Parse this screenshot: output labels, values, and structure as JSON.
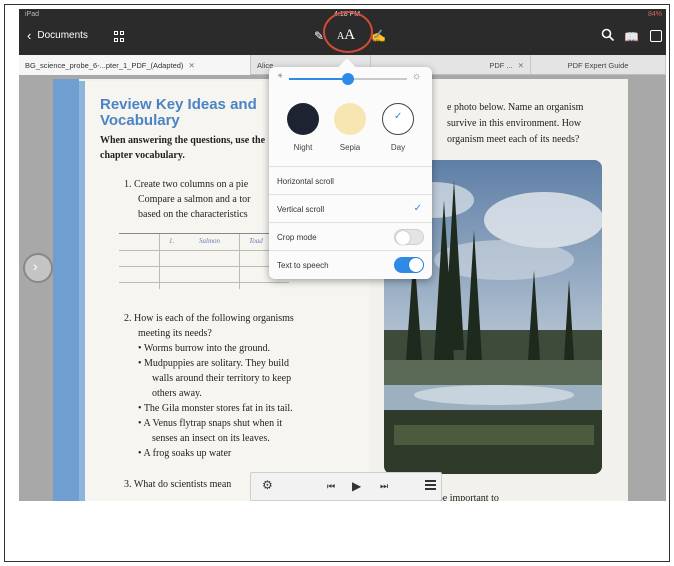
{
  "status": {
    "left": "iPad",
    "time": "4:18 PM",
    "right": "84%"
  },
  "toolbar": {
    "back_label": "Documents",
    "aa_label": "AA"
  },
  "tabs": [
    {
      "label": "BG_science_probe_6-...pter_1_PDF_(Adapted)",
      "active": true
    },
    {
      "label": "Alice",
      "active": false
    },
    {
      "label": "PDF ...",
      "active": false
    },
    {
      "label": "PDF Expert Guide",
      "active": false
    }
  ],
  "document": {
    "title_line1": "Review Key Ideas and",
    "title_line2": "Vocabulary",
    "instructions": "When answering the questions, use the chapter vocabulary.",
    "q1": [
      "1. Create two columns on a pie",
      "Compare a salmon and a tor",
      "based on the characteristics"
    ],
    "table_cells": [
      "1.",
      "Salmon",
      "Toad"
    ],
    "q2": [
      "2. How is each of the following organisms",
      "meeting its needs?",
      "• Worms burrow into the ground.",
      "• Mudpuppies are solitary. They build",
      "walls around their territory to keep",
      "others away.",
      "• The Gila monster stores fat in its tail.",
      "• A Venus flytrap snaps shut when it",
      "senses an insect on its leaves.",
      "• A frog soaks up water"
    ],
    "q3": "3. What do scientists mean",
    "q6": "6. When would it be important to",
    "right_text": [
      "e photo below. Name an organism",
      "survive in this environment. How",
      "organism meet each of its needs?"
    ]
  },
  "popover": {
    "brightness": 0.5,
    "themes": [
      {
        "label": "Night",
        "color": "#1d2331"
      },
      {
        "label": "Sepia",
        "color": "#f8e6b2"
      },
      {
        "label": "Day",
        "color": "#ffffff",
        "selected": true
      }
    ],
    "options": [
      {
        "label": "Horizontal scroll"
      },
      {
        "label": "Vertical scroll",
        "checked": true
      },
      {
        "label": "Crop mode",
        "toggle": false
      },
      {
        "label": "Text to speech",
        "toggle": true
      }
    ]
  },
  "colors": {
    "accent": "#2d8ae6",
    "title_blue": "#4a84c4",
    "highlight_ring": "#d24a3a",
    "toolbar": "#2b2b2b"
  },
  "icons": [
    "back-chevron-icon",
    "grid-icon",
    "pen-icon",
    "text-size-icon",
    "edit-icon",
    "search-icon",
    "bookmark-book-icon",
    "more-icon",
    "sun-icon",
    "gear-icon",
    "previous-icon",
    "play-icon",
    "next-icon",
    "list-icon",
    "page-nav-icon"
  ]
}
